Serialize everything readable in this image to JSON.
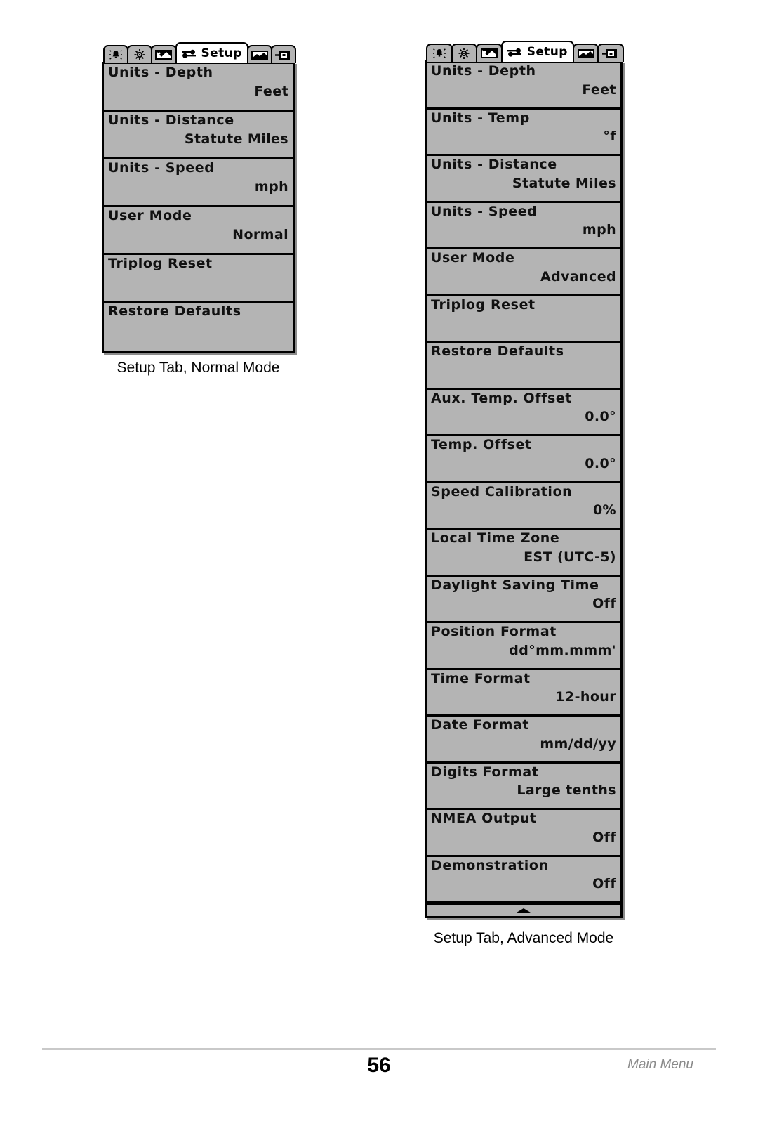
{
  "page": {
    "number": "56",
    "footer_label": "Main Menu"
  },
  "tabs": {
    "icons_left": [
      "alarm-bell-icon",
      "brightness-sun-icon",
      "sonar-chart-icon"
    ],
    "icons_right": [
      "chart-view-icon",
      "accessory-icon"
    ],
    "active_label": "Setup",
    "active_icon": "setup-sliders-icon"
  },
  "normal_panel": {
    "caption": "Setup Tab, Normal Mode",
    "rows": [
      {
        "label": "Units - Depth",
        "value": "Feet"
      },
      {
        "label": "Units - Distance",
        "value": "Statute Miles"
      },
      {
        "label": "Units - Speed",
        "value": "mph"
      },
      {
        "label": "User Mode",
        "value": "Normal"
      },
      {
        "label": "Triplog Reset",
        "value": ""
      },
      {
        "label": "Restore Defaults",
        "value": ""
      }
    ]
  },
  "advanced_panel": {
    "caption": "Setup Tab, Advanced Mode",
    "scroll_indicator": "scroll-up-arrow-icon",
    "rows": [
      {
        "label": "Units - Depth",
        "value": "Feet"
      },
      {
        "label": "Units - Temp",
        "value": "°f"
      },
      {
        "label": "Units - Distance",
        "value": "Statute Miles"
      },
      {
        "label": "Units - Speed",
        "value": "mph"
      },
      {
        "label": "User Mode",
        "value": "Advanced"
      },
      {
        "label": "Triplog Reset",
        "value": ""
      },
      {
        "label": "Restore Defaults",
        "value": ""
      },
      {
        "label": "Aux. Temp. Offset",
        "value": "0.0°"
      },
      {
        "label": "Temp. Offset",
        "value": "0.0°"
      },
      {
        "label": "Speed Calibration",
        "value": "0%"
      },
      {
        "label": "Local Time Zone",
        "value": "EST (UTC-5)"
      },
      {
        "label": "Daylight Saving Time",
        "value": "Off"
      },
      {
        "label": "Position Format",
        "value": "dd°mm.mmm'"
      },
      {
        "label": "Time Format",
        "value": "12-hour"
      },
      {
        "label": "Date Format",
        "value": "mm/dd/yy"
      },
      {
        "label": "Digits Format",
        "value": "Large tenths"
      },
      {
        "label": "NMEA Output",
        "value": "Off"
      },
      {
        "label": "Demonstration",
        "value": "Off"
      }
    ]
  },
  "colors": {
    "lcd_background": "#b4b4b4",
    "lcd_border": "#000000",
    "active_tab": "#ffffff",
    "footer_text": "#8a8a8a"
  }
}
